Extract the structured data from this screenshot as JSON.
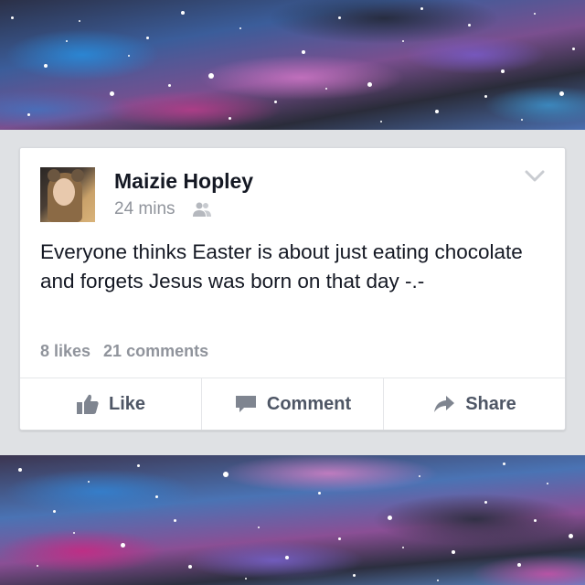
{
  "post": {
    "author": "Maizie Hopley",
    "time": "24 mins",
    "audience_icon": "friends-icon",
    "text": "Everyone thinks Easter is about just eating chocolate and forgets Jesus was born on that day -.-",
    "likes": "8 likes",
    "comments": "21 comments"
  },
  "actions": {
    "like_label": "Like",
    "comment_label": "Comment",
    "share_label": "Share"
  },
  "colors": {
    "card_background": "#ffffff",
    "page_background": "#dfe1e4",
    "author_text": "#141823",
    "muted_text": "#90949c",
    "action_text": "#4e5665"
  }
}
